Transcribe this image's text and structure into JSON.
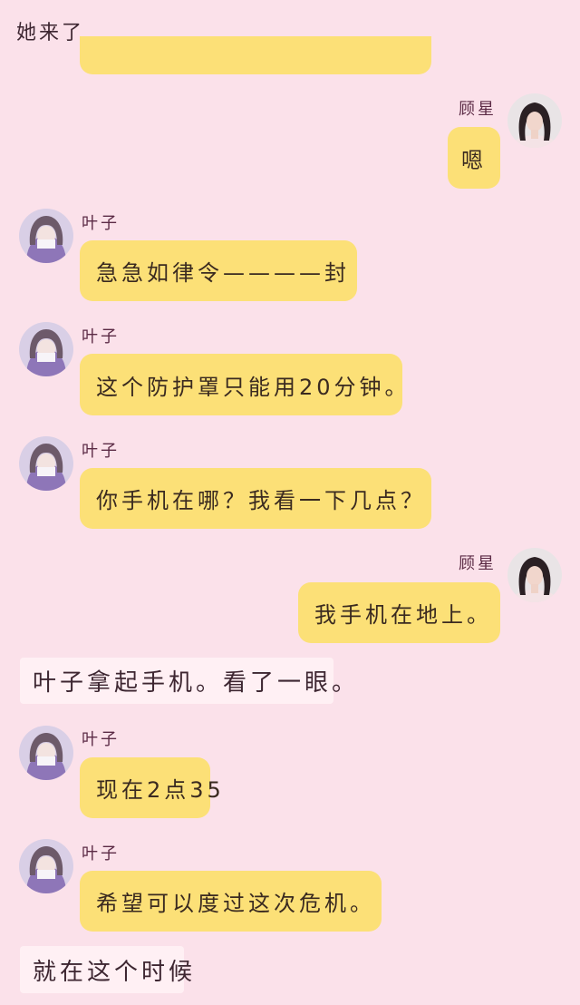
{
  "narration": {
    "top": "她来了",
    "mid": "叶子拿起手机。看了一眼。",
    "bottom": "就在这个时候"
  },
  "characters": {
    "left": {
      "name": "叶子",
      "avatar_icon": "girl-avatar-purple"
    },
    "right": {
      "name": "顾星",
      "avatar_icon": "girl-avatar-dark-hair"
    }
  },
  "messages": [
    {
      "side": "right",
      "text": "嗯"
    },
    {
      "side": "left",
      "text": "急急如律令————封"
    },
    {
      "side": "left",
      "text": "这个防护罩只能用20分钟。"
    },
    {
      "side": "left",
      "text": "你手机在哪？我看一下几点？"
    },
    {
      "side": "right",
      "text": "我手机在地上。"
    },
    {
      "side": "left",
      "text": "现在2点35"
    },
    {
      "side": "left",
      "text": "希望可以度过这次危机。"
    }
  ],
  "colors": {
    "background": "#fbe1ea",
    "bubble": "#fce077",
    "narration_bg": "#fff0f4",
    "name_text": "#5b2a45"
  }
}
